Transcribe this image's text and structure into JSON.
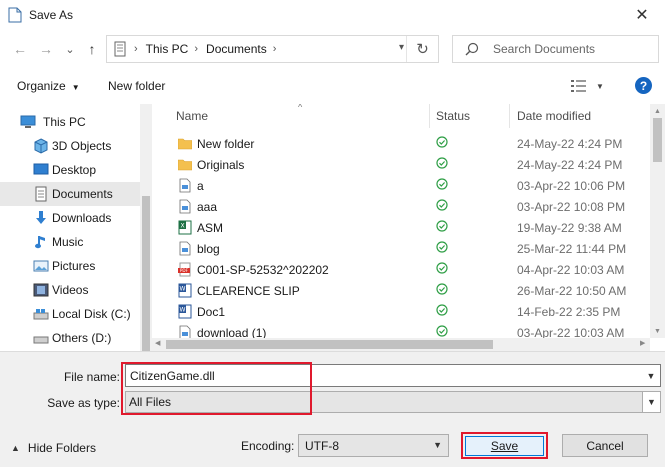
{
  "window": {
    "title": "Save As",
    "close_glyph": "✕"
  },
  "nav": {
    "back_glyph": "←",
    "forward_glyph": "→",
    "recent_glyph": "⌄",
    "up_glyph": "↑",
    "breadcrumb": [
      "This PC",
      "Documents"
    ],
    "separator": "›",
    "refresh_glyph": "↻",
    "search_placeholder": "Search Documents"
  },
  "toolbar": {
    "organize": "Organize",
    "new_folder": "New folder",
    "help": "?"
  },
  "sidebar": {
    "items": [
      {
        "label": "This PC",
        "icon": "pc-icon"
      },
      {
        "label": "3D Objects",
        "icon": "cube-icon"
      },
      {
        "label": "Desktop",
        "icon": "desktop-icon"
      },
      {
        "label": "Documents",
        "icon": "document-icon",
        "selected": true
      },
      {
        "label": "Downloads",
        "icon": "download-icon"
      },
      {
        "label": "Music",
        "icon": "music-icon"
      },
      {
        "label": "Pictures",
        "icon": "picture-icon"
      },
      {
        "label": "Videos",
        "icon": "video-icon"
      },
      {
        "label": "Local Disk (C:)",
        "icon": "drive-icon"
      },
      {
        "label": "Others (D:)",
        "icon": "drive-icon"
      }
    ]
  },
  "files": {
    "columns": {
      "name": "Name",
      "status": "Status",
      "date": "Date modified"
    },
    "rows": [
      {
        "name": "New folder",
        "type": "folder",
        "date": "24-May-22 4:24 PM"
      },
      {
        "name": "Originals",
        "type": "folder",
        "date": "24-May-22 4:24 PM"
      },
      {
        "name": "a",
        "type": "doc",
        "date": "03-Apr-22 10:06 PM"
      },
      {
        "name": "aaa",
        "type": "doc",
        "date": "03-Apr-22 10:08 PM"
      },
      {
        "name": "ASM",
        "type": "excel",
        "date": "19-May-22 9:38 AM"
      },
      {
        "name": "blog",
        "type": "doc",
        "date": "25-Mar-22 11:44 PM"
      },
      {
        "name": "C001-SP-52532^202202",
        "type": "pdf",
        "date": "04-Apr-22 10:03 AM"
      },
      {
        "name": "CLEARENCE SLIP",
        "type": "word",
        "date": "26-Mar-22 10:50 AM"
      },
      {
        "name": "Doc1",
        "type": "word",
        "date": "14-Feb-22 2:35 PM"
      },
      {
        "name": "download (1)",
        "type": "doc",
        "date": "03-Apr-22 10:03 AM"
      }
    ]
  },
  "form": {
    "file_name_label": "File name:",
    "file_name_value": "CitizenGame.dll",
    "save_type_label": "Save as type:",
    "save_type_value": "All Files",
    "hide_folders": "Hide Folders",
    "encoding_label": "Encoding:",
    "encoding_value": "UTF-8",
    "save": "Save",
    "cancel": "Cancel"
  },
  "colors": {
    "highlight": "#e0192d",
    "folder": "#f4c04e",
    "status_ok": "#2e9e45",
    "help": "#1565c0"
  }
}
